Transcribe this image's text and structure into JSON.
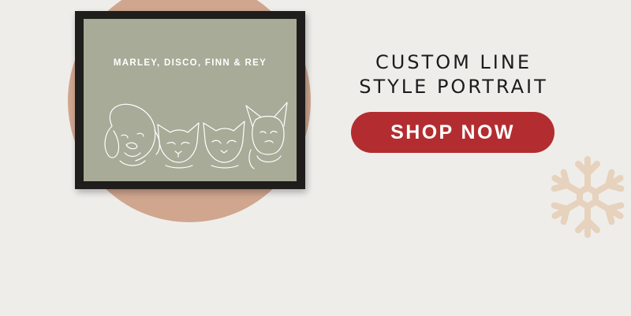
{
  "banner": {
    "headline_line1": "CUSTOM LINE",
    "headline_line2": "STYLE PORTRAIT",
    "cta_label": "SHOP NOW"
  },
  "portrait": {
    "names": "MARLEY, DISCO, FINN & REY"
  },
  "colors": {
    "background": "#efedea",
    "circle": "#d0a68f",
    "frame": "#1f1e1c",
    "mat": "#a7ab97",
    "cta": "#b32d30",
    "snowflake": "#e6d2bd"
  }
}
